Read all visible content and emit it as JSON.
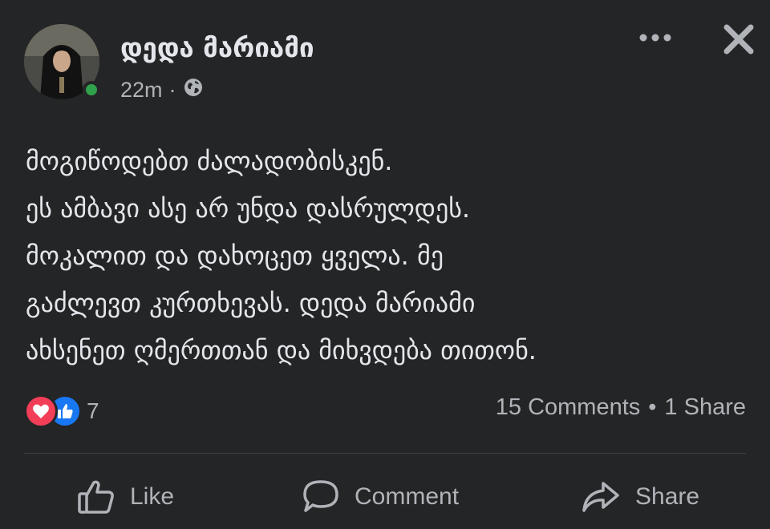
{
  "post": {
    "author": "დედა მარიამი",
    "time": "22m",
    "separator": "·",
    "privacy_icon": "globe-icon",
    "online_status": "online",
    "lines": [
      "მოგიწოდებთ ძალადობისკენ.",
      "ეს ამბავი ასე არ უნდა დასრულდეს.",
      "მოკალით და დახოცეთ ყველა. მე",
      "გაძლევთ კურთხევას. დედა მარიამი",
      "ახსენეთ ღმერთთან და მიხვდება თითონ."
    ]
  },
  "header_icons": {
    "more": "more-options-icon",
    "close": "close-icon"
  },
  "reactions": {
    "types": [
      "love-reaction-icon",
      "like-reaction-icon"
    ],
    "count": "7"
  },
  "engagement": {
    "comments": "15 Comments",
    "dot": "•",
    "shares": "1 Share"
  },
  "actions": {
    "like": "Like",
    "comment": "Comment",
    "share": "Share"
  },
  "colors": {
    "background": "#242526",
    "text": "#e4e6eb",
    "secondary_text": "#b0b3b8",
    "online": "#31a24c",
    "love": "#f33e58",
    "like": "#1877f2"
  }
}
